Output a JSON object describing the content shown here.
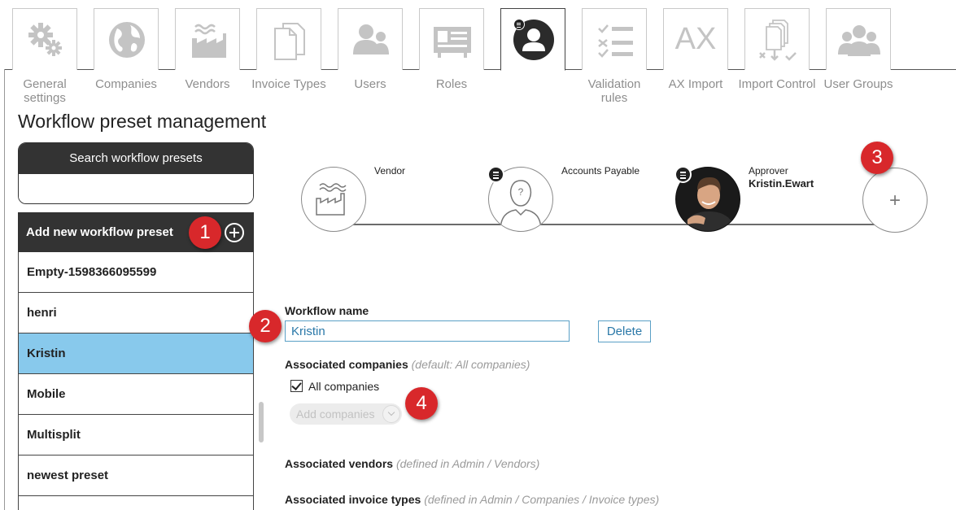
{
  "tabs": [
    {
      "label": "General settings",
      "icon": "gears-icon",
      "active": false
    },
    {
      "label": "Companies",
      "icon": "globe-icon",
      "active": false
    },
    {
      "label": "Vendors",
      "icon": "factory-icon",
      "active": false
    },
    {
      "label": "Invoice Types",
      "icon": "documents-icon",
      "active": false
    },
    {
      "label": "Users",
      "icon": "users-icon",
      "active": false
    },
    {
      "label": "Roles",
      "icon": "id-card-icon",
      "active": false
    },
    {
      "label": "",
      "icon": "user-workflow-icon",
      "active": true
    },
    {
      "label": "Validation rules",
      "icon": "checklist-icon",
      "active": false
    },
    {
      "label": "AX Import",
      "icon": "ax-text-icon",
      "active": false
    },
    {
      "label": "Import Control",
      "icon": "import-stack-icon",
      "active": false
    },
    {
      "label": "User Groups",
      "icon": "user-groups-icon",
      "active": false
    }
  ],
  "tab_icon_text": {
    "ax": "AX"
  },
  "page_title": "Workflow preset management",
  "sidebar": {
    "search_title": "Search workflow presets",
    "search_value": "",
    "add_label": "Add new workflow preset",
    "presets": [
      "Empty-1598366095599",
      "henri",
      "Kristin",
      "Mobile",
      "Multisplit",
      "newest preset",
      ""
    ],
    "selected": "Kristin"
  },
  "callouts": [
    "1",
    "2",
    "3",
    "4"
  ],
  "workflow": {
    "steps": [
      {
        "title": "Vendor",
        "user": "",
        "icon": "factory-icon"
      },
      {
        "title": "Accounts Payable",
        "user": "",
        "icon": "unknown-person-icon"
      },
      {
        "title": "Approver",
        "user": "Kristin.Ewart",
        "icon": "avatar"
      }
    ],
    "add_step": "+"
  },
  "form": {
    "name_label": "Workflow name",
    "name_value": "Kristin",
    "delete_label": "Delete",
    "companies_label": "Associated companies",
    "companies_hint": "(default: All companies)",
    "all_companies_label": "All companies",
    "all_companies_checked": true,
    "add_companies_placeholder": "Add companies",
    "vendors_label": "Associated vendors",
    "vendors_hint": "(defined in Admin / Vendors)",
    "invoice_types_label": "Associated invoice types",
    "invoice_types_hint": "(defined in Admin / Companies / Invoice types)"
  },
  "colors": {
    "header_dark": "#333333",
    "selected_row": "#88c9ec",
    "callout": "#d8282b",
    "input_border": "#5aa0c6",
    "tab_icon": "#c4c4c4"
  }
}
